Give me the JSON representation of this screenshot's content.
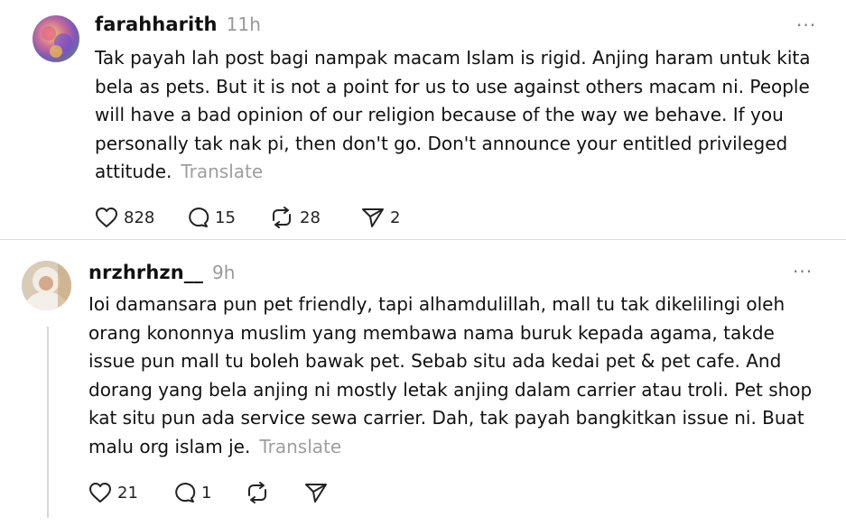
{
  "posts": [
    {
      "username": "farahharith",
      "time": "11h",
      "more": "···",
      "text": "Tak payah lah post bagi nampak macam Islam is rigid. Anjing haram untuk kita bela as pets. But it is not a point for us to use against others macam ni. People will have a bad opinion of our religion because of the way we behave. If you personally tak nak pi, then don't go. Don't announce your entitled privileged attitude.",
      "translate": "Translate",
      "likes": "828",
      "replies": "15",
      "reposts": "28",
      "shares": "2"
    },
    {
      "username": "nrzhrhzn__",
      "time": "9h",
      "more": "···",
      "text": "Ioi damansara pun pet friendly, tapi alhamdulillah, mall tu tak dikelilingi oleh orang kononnya muslim yang membawa nama buruk kepada agama, takde issue pun mall tu boleh bawak pet. Sebab situ ada kedai pet & pet cafe. And dorang yang bela anjing ni mostly letak anjing dalam carrier atau troli. Pet shop kat situ pun ada service sewa carrier. Dah, tak payah bangkitkan issue ni. Buat malu org islam je.",
      "translate": "Translate",
      "likes": "21",
      "replies": "1"
    }
  ],
  "icons": {
    "like": "heart-icon",
    "reply": "comment-icon",
    "repost": "repost-icon",
    "share": "send-icon"
  },
  "colors": {
    "text": "#111111",
    "muted": "#9a9a9a",
    "divider": "#dadada",
    "background": "#ffffff"
  }
}
